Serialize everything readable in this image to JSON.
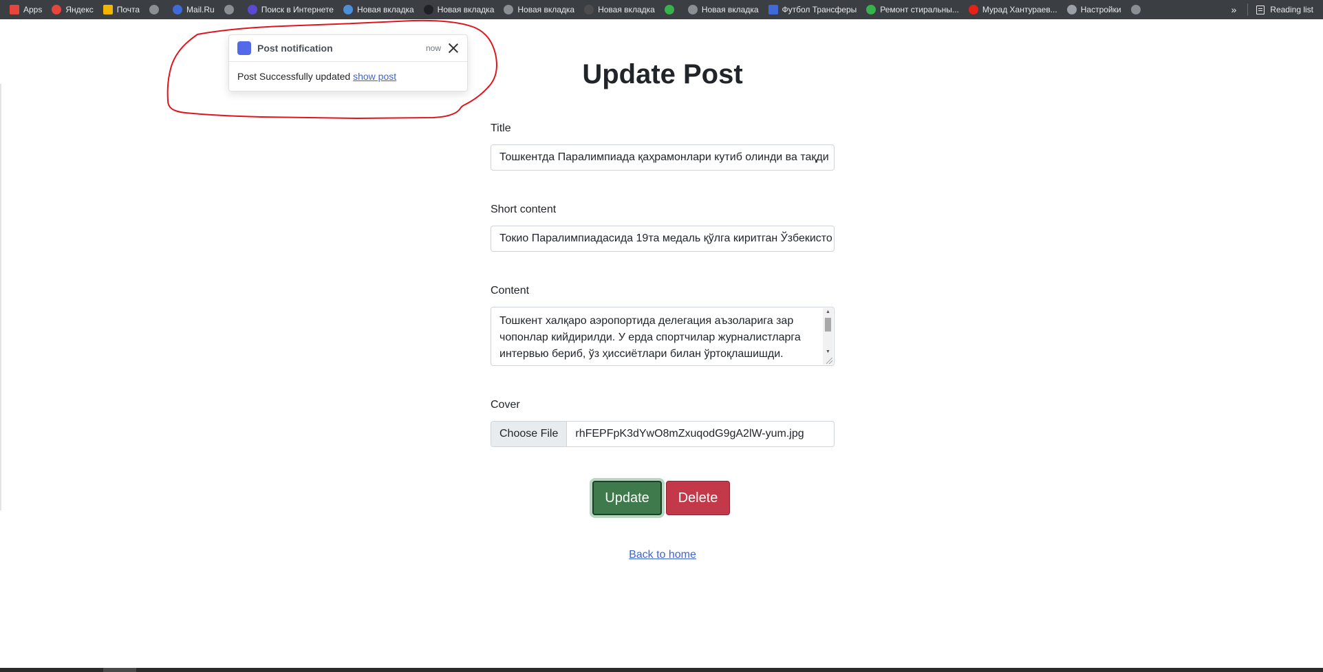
{
  "bookmarks": [
    {
      "label": "Apps",
      "icon": "apps-grid-icon",
      "color": "#e8453c"
    },
    {
      "label": "Яндекс",
      "icon": "yandex-icon",
      "color": "#e8453c"
    },
    {
      "label": "Почта",
      "icon": "mail-icon",
      "color": "#f2b600"
    },
    {
      "label": "",
      "icon": "globe-icon",
      "color": "#8a8f95"
    },
    {
      "label": "Mail.Ru",
      "icon": "at-icon",
      "color": "#3f6bd8"
    },
    {
      "label": "",
      "icon": "globe-icon",
      "color": "#8a8f95"
    },
    {
      "label": "Поиск в Интернете",
      "icon": "search-icon",
      "color": "#5b49d4"
    },
    {
      "label": "Новая вкладка",
      "icon": "music-icon",
      "color": "#4a8fd8"
    },
    {
      "label": "Новая вкладка",
      "icon": "arch-icon",
      "color": "#202124"
    },
    {
      "label": "Новая вкладка",
      "icon": "google-icon",
      "color": "#8a8f95"
    },
    {
      "label": "Новая вкладка",
      "icon": "owl-icon",
      "color": "#4d4d4d"
    },
    {
      "label": "",
      "icon": "bolt-icon",
      "color": "#37b24d"
    },
    {
      "label": "Новая вкладка",
      "icon": "globe-icon",
      "color": "#8a8f95"
    },
    {
      "label": "Футбол Трансферы",
      "icon": "sb-icon",
      "color": "#3f6bd8"
    },
    {
      "label": "Ремонт стиральны...",
      "icon": "z-icon",
      "color": "#37b24d"
    },
    {
      "label": "Мурад Хантураев...",
      "icon": "youtube-icon",
      "color": "#e62117"
    },
    {
      "label": "Настройки",
      "icon": "gear-icon",
      "color": "#9aa0a6"
    },
    {
      "label": "",
      "icon": "google-icon",
      "color": "#8a8f95"
    }
  ],
  "bookmarks_right": {
    "more": "»",
    "reading_list": "Reading list"
  },
  "page": {
    "title": "Update Post",
    "fields": {
      "title_label": "Title",
      "title_value": "Тошкентда Паралимпиада қаҳрамонлари кутиб олинди ва тақди",
      "short_label": "Short content",
      "short_value": "Токио Паралимпиадасида 19та медаль қўлга киритган Ўзбекисто",
      "content_label": "Content",
      "content_value": "Тошкент халқаро аэропортида делегация аъзоларига зар чопонлар кийдирилди. У ерда спортчилар журналистларга интервью бериб, ўз ҳиссиётлари билан ўртоқлашишди.",
      "cover_label": "Cover",
      "file_button": "Choose File",
      "file_name": "rhFEPFpK3dYwO8mZxuqodG9gA2lW-yum.jpg"
    },
    "update_label": "Update",
    "delete_label": "Delete",
    "back_label": "Back to home"
  },
  "toast": {
    "title": "Post notification",
    "time": "now",
    "message": "Post Successfully updated",
    "link": "show post",
    "accent": "#5468ea"
  },
  "colors": {
    "bookmark_bar": "#3b3f44",
    "update_button": "#3f7a4d",
    "delete_button": "#c3394a",
    "link": "#3d63d6",
    "annotation": "#e1131f"
  }
}
